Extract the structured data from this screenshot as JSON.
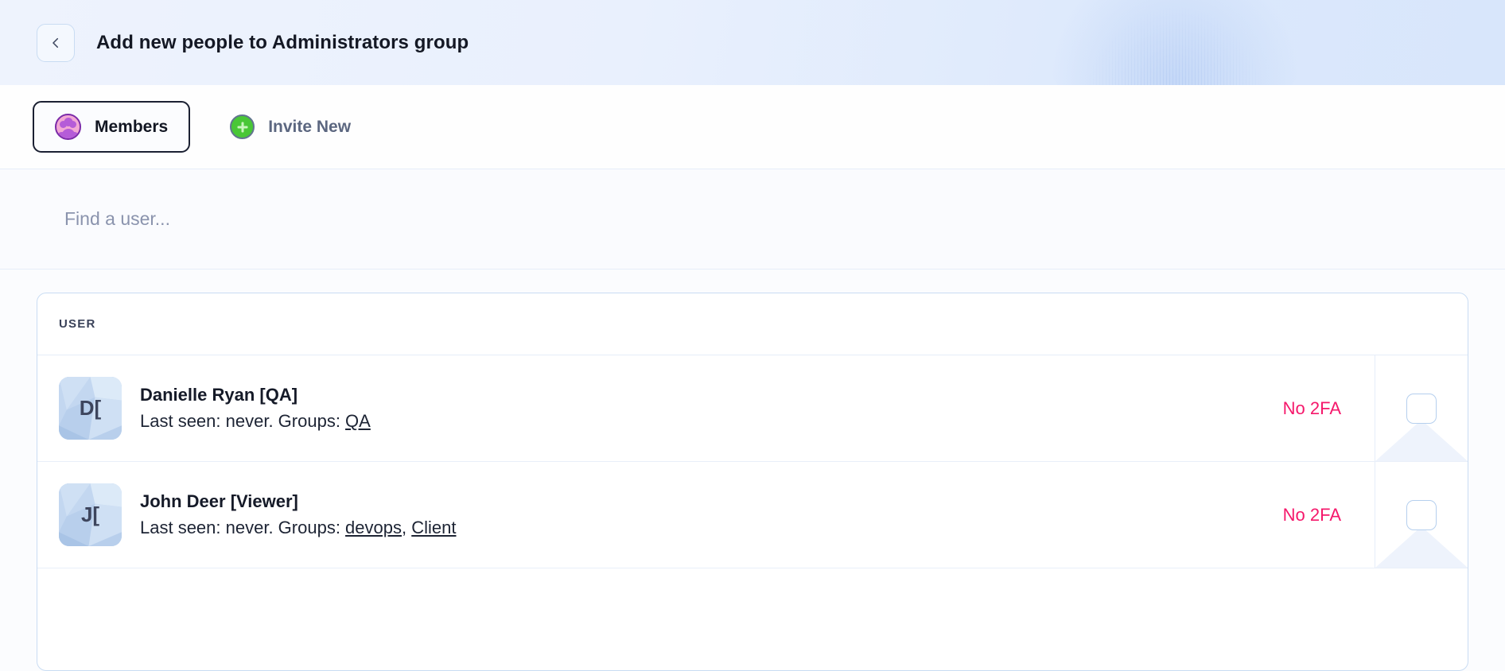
{
  "header": {
    "back_icon": "chevron-left-icon",
    "title": "Add new people to Administrators group"
  },
  "tabs": [
    {
      "id": "members",
      "label": "Members",
      "icon": "members-group-icon",
      "active": true
    },
    {
      "id": "invite-new",
      "label": "Invite New",
      "icon": "plus-circle-icon",
      "active": false
    }
  ],
  "search": {
    "placeholder": "Find a user...",
    "value": ""
  },
  "table": {
    "columns": {
      "user": "USER"
    },
    "rows": [
      {
        "avatar_initials": "D[",
        "name": "Danielle Ryan [QA]",
        "meta_prefix": "Last seen: never. Groups: ",
        "groups": [
          "QA"
        ],
        "twofa_status": "No 2FA",
        "selected": false
      },
      {
        "avatar_initials": "J[",
        "name": "John Deer [Viewer]",
        "meta_prefix": "Last seen: never. Groups: ",
        "groups": [
          "devops",
          "Client"
        ],
        "twofa_status": "No 2FA",
        "selected": false
      }
    ]
  },
  "colors": {
    "header_gradient_start": "#eef3fd",
    "header_gradient_end": "#d8e6fb",
    "danger": "#f5186b",
    "active_tab_border": "#1b2032",
    "members_icon_ring": "#7b2aa8",
    "members_icon_fill": "#f2a8d4",
    "invite_icon_fill": "#49c736",
    "card_border": "#c9dcf3"
  }
}
